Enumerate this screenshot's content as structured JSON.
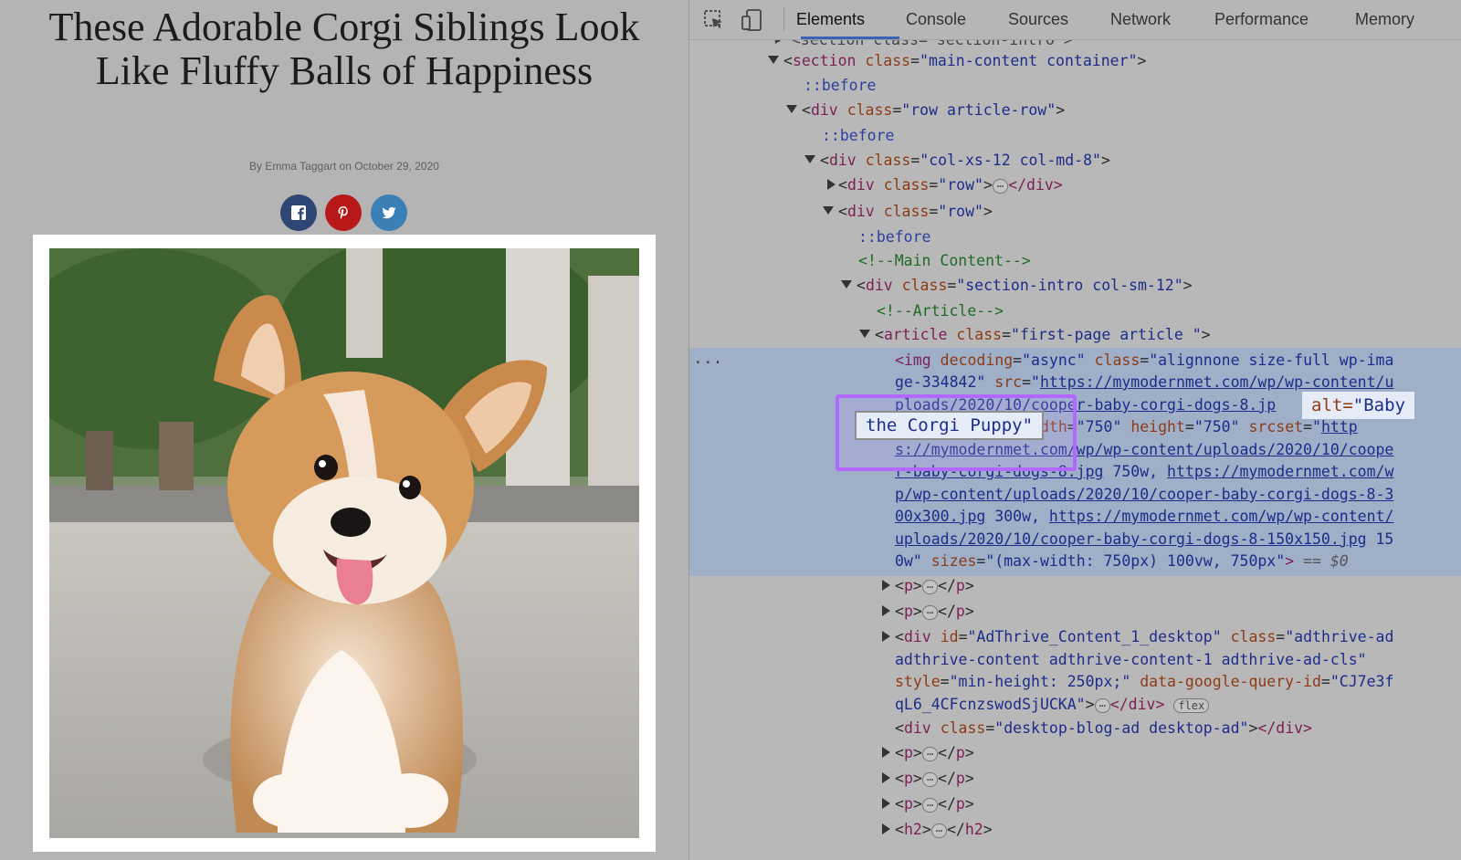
{
  "article": {
    "title": "These Adorable Corgi Siblings Look Like Fluffy Balls of Happiness",
    "byline": "By Emma Taggart on October 29, 2020",
    "social_buttons": [
      {
        "icon": "facebook-icon",
        "color": "#2d4673"
      },
      {
        "icon": "pinterest-icon",
        "color": "#b91818"
      },
      {
        "icon": "twitter-icon",
        "color": "#3a7fb5"
      }
    ]
  },
  "devtools": {
    "tabs": [
      "Elements",
      "Console",
      "Sources",
      "Network",
      "Performance",
      "Memory"
    ],
    "active_tab": "Elements",
    "tree": {
      "partial_top": "▸ <section class=\"section-intro\">",
      "section_tag": "section",
      "section_attr": "class",
      "section_val": "\"main-content container\"",
      "before": "::before",
      "div_tag": "div",
      "row_article_val": "\"row article-row\"",
      "col_val": "\"col-xs-12 col-md-8\"",
      "row_val": "\"row\"",
      "div_close": "</div>",
      "comment_main": "<!--Main Content-->",
      "intro_val": "\"section-intro col-sm-12\"",
      "comment_article": "<!--Article-->",
      "article_tag": "article",
      "article_val": "\"first-page article \"",
      "img": {
        "l1_a": "<img ",
        "decoding": "decoding",
        "decoding_val": "\"async\"",
        "class_val_1": "\"alignnone size-full wp-ima",
        "l2_a": "ge-334842\"",
        "src": "src",
        "src_link_1": "https://mymodernmet.com/wp/wp-content/u",
        "l3_link": "ploads/2020/10/cooper-baby-corgi-dogs-8.jp",
        "l4_width_val": "\"750\"",
        "l4_height": "height",
        "l4_height_val": "\"750\"",
        "l4_srcset": "srcset",
        "l4_link": "http",
        "l5_link": "s://mymodernmet.com/wp/wp-content/uploads/2020/10/coope",
        "l6_link": "r-baby-corgi-dogs-8.jpg",
        "l6_text": " 750w, ",
        "l6_link2": "https://mymodernmet.com/w",
        "l7_link": "p/wp-content/uploads/2020/10/cooper-baby-corgi-dogs-8-3",
        "l8_link": "00x300.jpg",
        "l8_text": " 300w, ",
        "l8_link2": "https://mymodernmet.com/wp/wp-content/",
        "l9_link": "uploads/2020/10/cooper-baby-corgi-dogs-8-150x150.jpg",
        "l9_text": " 15",
        "l10_text": "0w\"",
        "l10_sizes": "sizes",
        "l10_sizes_val": "\"(max-width: 750px) 100vw, 750px\"",
        "l10_end": ">",
        "l10_eq": " == $0"
      },
      "p_tag": "p",
      "adthrive_id_val": "\"AdThrive_Content_1_desktop\"",
      "adthrive_class_val_1": "\"adthrive-ad",
      "adthrive_l2": "adthrive-content adthrive-content-1 adthrive-ad-cls\"",
      "adthrive_style": "style",
      "adthrive_style_val": "\"min-height: 250px;\"",
      "adthrive_gq": "data-google-query-id",
      "adthrive_gq_val": "\"CJ7e3f",
      "adthrive_l4_val": "qL6_4CFcnzswodSjUCKA\"",
      "flex_pill": "flex",
      "desktop_ad_val": "\"desktop-blog-ad desktop-ad\"",
      "h2_tag": "h2",
      "ellipsis": "⋯"
    },
    "tooltip_alt_attr": "alt=",
    "tooltip_alt_val": "\"Baby",
    "highlight_text": "the Corgi Puppy\""
  }
}
